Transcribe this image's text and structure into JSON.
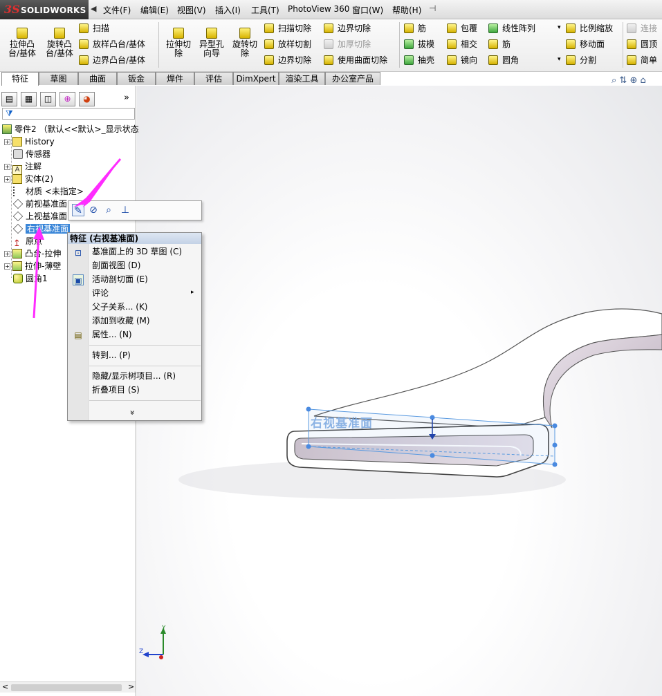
{
  "app": {
    "brand_prefix": "3S",
    "brand": "SOLIDWORKS",
    "menu": [
      "文件(F)",
      "编辑(E)",
      "视图(V)",
      "插入(I)",
      "工具(T)",
      "PhotoView 360",
      "窗口(W)",
      "帮助(H)"
    ],
    "menu_pin": "⊣"
  },
  "toolbar": {
    "big_buttons": [
      {
        "line1": "拉伸凸",
        "line2": "台/基体"
      },
      {
        "line1": "旋转凸",
        "line2": "台/基体"
      },
      {
        "line1": "拉伸切",
        "line2": "除"
      },
      {
        "line1": "异型孔",
        "line2": "向导"
      },
      {
        "line1": "旋转切",
        "line2": "除"
      }
    ],
    "col1": [
      "扫描",
      "放样凸台/基体",
      "边界凸台/基体"
    ],
    "col2": [
      "扫描切除",
      "放样切割",
      "边界切除"
    ],
    "col3": [
      "边界切除",
      "加厚切除",
      "使用曲面切除"
    ],
    "col4": [
      "筋",
      "拔模",
      "抽壳"
    ],
    "col5": [
      "包覆",
      "相交",
      "镜向"
    ],
    "col6": [
      "线性阵列",
      "筋",
      "圆角"
    ],
    "col7": [
      "比例缩放",
      "移动面",
      "分割"
    ],
    "col8": [
      "连接",
      "圆顶",
      "简单"
    ]
  },
  "tabs": [
    "特征",
    "草图",
    "曲面",
    "钣金",
    "焊件",
    "评估",
    "DimXpert",
    "渲染工具",
    "办公室产品"
  ],
  "panel": {
    "more": "»",
    "tree": [
      {
        "label": "零件2 （默认<<默认>_显示状态",
        "icon": "part-icon"
      },
      {
        "label": "History",
        "icon": "history-folder-icon"
      },
      {
        "label": "传感器",
        "icon": "sensor-icon"
      },
      {
        "label": "注解",
        "icon": "annotation-icon"
      },
      {
        "label": "实体(2)",
        "icon": "solid-bodies-icon"
      },
      {
        "label": "材质 <未指定>",
        "icon": "material-icon"
      },
      {
        "label": "前视基准面",
        "icon": "plane-icon"
      },
      {
        "label": "上视基准面",
        "icon": "plane-icon"
      },
      {
        "label": "右视基准面",
        "icon": "plane-icon"
      },
      {
        "label": "原点",
        "icon": "origin-icon"
      },
      {
        "label": "凸台-拉伸",
        "icon": "boss-extrude-icon"
      },
      {
        "label": "拉伸-薄壁",
        "icon": "thin-extrude-icon"
      },
      {
        "label": "圆角1",
        "icon": "fillet-icon"
      }
    ]
  },
  "context_menu": {
    "header": "特征 (右视基准面)",
    "items": [
      "基准面上的 3D 草图 (C)",
      "剖面视图 (D)",
      "活动剖切面 (E)",
      "评论",
      "父子关系... (K)",
      "添加到收藏 (M)",
      "属性... (N)",
      "转到... (P)",
      "隐藏/显示树项目... (R)",
      "折叠项目 (S)"
    ],
    "submenu_arrow": "▸",
    "expand": "»"
  },
  "viewport": {
    "plane_label": "右视基准面",
    "triad_y": "Y",
    "triad_z": "Z"
  },
  "colors": {
    "accent": "#3a86d8",
    "arrow": "#ff2cff"
  }
}
